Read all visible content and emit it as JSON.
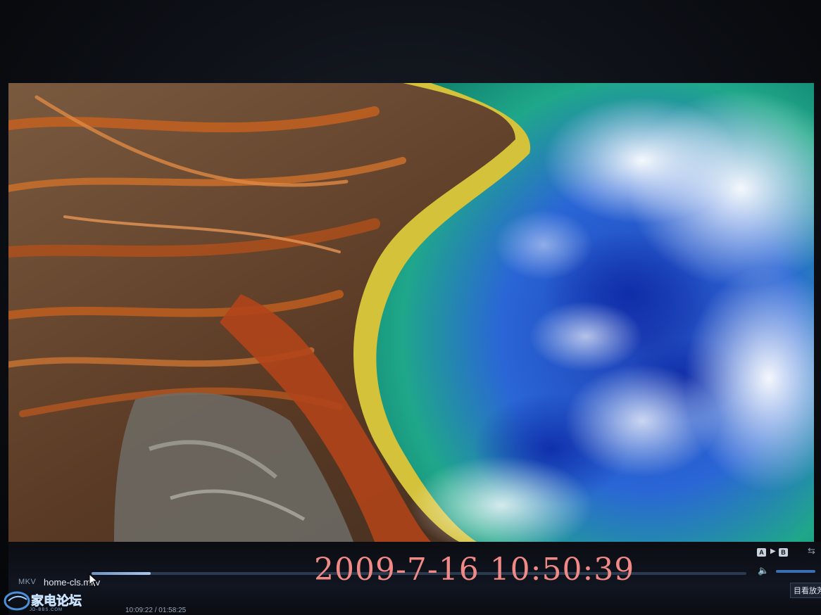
{
  "player": {
    "format_tag": "MKV",
    "filename": "home-cls.mkv",
    "time": "10:09:22 / 01:58:25",
    "progress": 0.09,
    "volume": 0.8,
    "ab_start": "A",
    "ab_end": "B",
    "side_button": "目看放芳"
  },
  "camera_stamp": "2009-7-16 10:50:39",
  "watermark": {
    "name": "家电论坛",
    "site": "JD-BBS.COM"
  },
  "icons": [
    "cursor-icon",
    "volume-icon",
    "repeat-icon",
    "ab-arrow-icon"
  ],
  "colors": {
    "stamp": "#f08a86",
    "pool_deep": "#1d3fb5",
    "pool_teal": "#1fa78a",
    "rim_yellow": "#d4c23a",
    "mat_orange": "#c2561c",
    "rock_brown": "#6a4a35"
  }
}
